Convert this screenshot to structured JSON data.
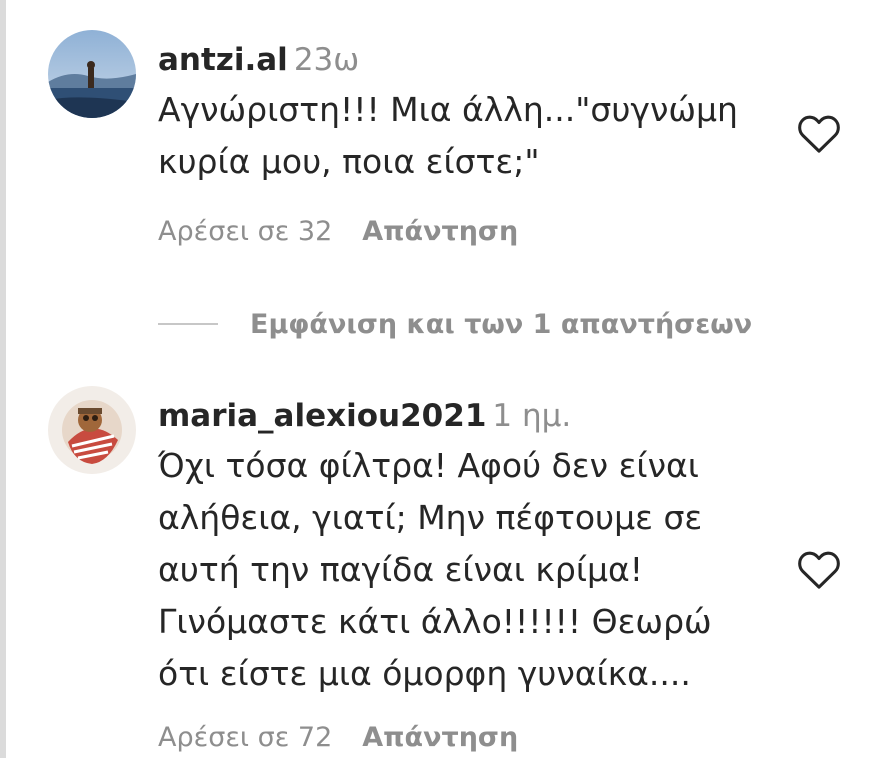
{
  "comments": [
    {
      "username": "antzi.al",
      "timestamp": "23ω",
      "lines": [
        "Αγνώριστη!!! Μια άλλη...\"συγνώμη",
        "κυρία μου, ποια είστε;\""
      ],
      "likes_label": "Αρέσει σε 32",
      "reply_label": "Απάντηση",
      "like_icon": "heart-outline-icon"
    },
    {
      "username": "maria_alexiou2021",
      "timestamp": "1 ημ.",
      "lines": [
        "Όχι τόσα φίλτρα! Αφού δεν είναι",
        "αλήθεια, γιατί; Μην πέφτουμε σε",
        "αυτή την παγίδα είναι κρίμα!",
        "Γινόμαστε κάτι άλλο!!!!!! Θεωρώ",
        "ότι είστε μια όμορφη γυναίκα...."
      ],
      "likes_label": "Αρέσει σε 72",
      "reply_label": "Απάντηση",
      "like_icon": "heart-outline-icon"
    }
  ],
  "view_replies": {
    "label": "Εμφάνιση και των 1 απαντήσεων"
  },
  "colors": {
    "text_primary": "#262626",
    "text_secondary": "#8e8e8e",
    "divider": "#c7c7c7"
  }
}
